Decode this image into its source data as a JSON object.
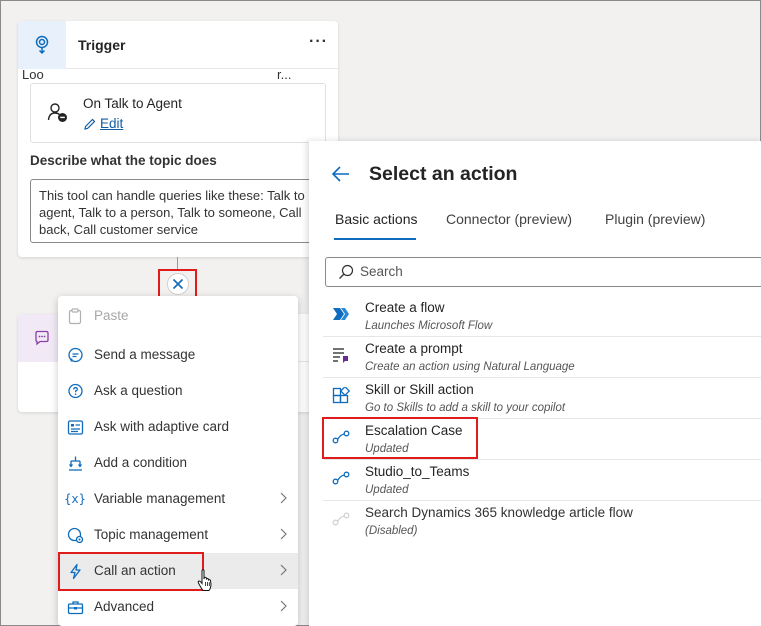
{
  "trigger": {
    "title": "Trigger",
    "more": "···",
    "event_title": "On Talk to Agent",
    "edit_label": "Edit",
    "describe_label": "Describe what the topic does",
    "describe_text": "This tool can handle queries like these: Talk to agent, Talk to a person, Talk to someone, Call back, Call customer service"
  },
  "bg_card": {
    "text_left": "Loo",
    "text_right": "r..."
  },
  "menu": {
    "items": [
      {
        "label": "Paste",
        "icon": "clipboard-icon",
        "disabled": true
      },
      {
        "label": "Send a message",
        "icon": "chat-icon"
      },
      {
        "label": "Ask a question",
        "icon": "question-icon"
      },
      {
        "label": "Ask with adaptive card",
        "icon": "card-icon"
      },
      {
        "label": "Add a condition",
        "icon": "branch-icon"
      },
      {
        "label": "Variable management",
        "icon": "variable-icon"
      },
      {
        "label": "Topic management",
        "icon": "topic-icon"
      },
      {
        "label": "Call an action",
        "icon": "lightning-icon"
      },
      {
        "label": "Advanced",
        "icon": "toolbox-icon"
      }
    ]
  },
  "panel": {
    "title": "Select an action",
    "tabs": [
      "Basic actions",
      "Connector (preview)",
      "Plugin (preview)"
    ],
    "search_placeholder": "Search",
    "actions": [
      {
        "title": "Create a flow",
        "subtitle": "Launches Microsoft Flow",
        "icon": "power-automate-icon"
      },
      {
        "title": "Create a prompt",
        "subtitle": "Create an action using Natural Language",
        "icon": "prompt-icon"
      },
      {
        "title": "Skill or Skill action",
        "subtitle": "Go to Skills to add a skill to your copilot",
        "icon": "skill-icon"
      },
      {
        "title": "Escalation Case",
        "subtitle": "Updated",
        "icon": "flow-icon"
      },
      {
        "title": "Studio_to_Teams",
        "subtitle": "Updated",
        "icon": "flow-icon"
      },
      {
        "title": "Search Dynamics 365 knowledge article flow",
        "subtitle": "(Disabled)",
        "icon": "flow-icon"
      }
    ]
  },
  "colors": {
    "accent": "#0f6cbd",
    "highlight": "#e01b1b"
  }
}
